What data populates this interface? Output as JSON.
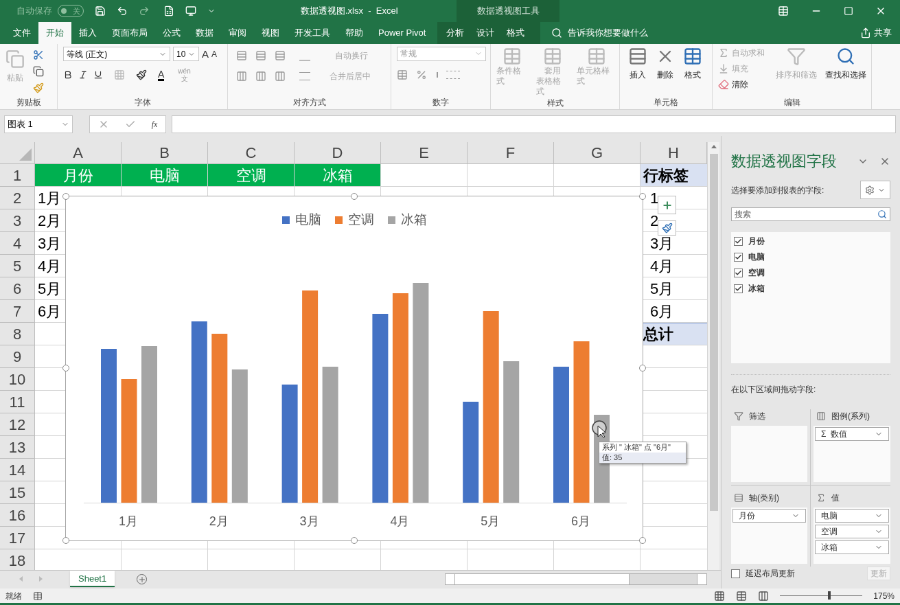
{
  "title_bar": {
    "autosave_label": "自动保存",
    "autosave_toggle": "关",
    "file_title": "数据透视图.xlsx  -  Excel",
    "context_title": "数据透视图工具"
  },
  "tabs": [
    {
      "label": "文件",
      "selected": false
    },
    {
      "label": "开始",
      "selected": true
    },
    {
      "label": "插入",
      "selected": false
    },
    {
      "label": "页面布局",
      "selected": false
    },
    {
      "label": "公式",
      "selected": false
    },
    {
      "label": "数据",
      "selected": false
    },
    {
      "label": "审阅",
      "selected": false
    },
    {
      "label": "视图",
      "selected": false
    },
    {
      "label": "开发工具",
      "selected": false
    },
    {
      "label": "帮助",
      "selected": false
    },
    {
      "label": "Power Pivot",
      "selected": false
    }
  ],
  "context_tabs": [
    {
      "label": "分析",
      "selected": false
    },
    {
      "label": "设计",
      "selected": false
    },
    {
      "label": "格式",
      "selected": false
    }
  ],
  "tell_me": "告诉我你想要做什么",
  "share": "共享",
  "ribbon": {
    "clipboard": {
      "paste": "粘贴",
      "paste_disabled": true,
      "group": "剪贴板"
    },
    "font": {
      "name": "等线 (正文)",
      "size": "10",
      "grow": "A",
      "shrink": "A",
      "color_letter": "A",
      "phonetic_top": "wén",
      "phonetic_bottom": "文",
      "group": "字体"
    },
    "alignment": {
      "wrap": "自动换行",
      "merge": "合并后居中",
      "disabled": true,
      "group": "对齐方式"
    },
    "number": {
      "format": "常规",
      "group": "数字"
    },
    "styles": {
      "items": [
        {
          "lines": [
            "条件格式"
          ],
          "disabled": true
        },
        {
          "lines": [
            "套用",
            "表格格式"
          ],
          "disabled": true
        },
        {
          "lines": [
            "单元格样式"
          ],
          "disabled": true
        }
      ],
      "group": "样式"
    },
    "cells": {
      "items": [
        {
          "label": "插入",
          "kind": "insert"
        },
        {
          "label": "删除",
          "kind": "delete"
        },
        {
          "label": "格式",
          "kind": "format"
        }
      ],
      "group": "单元格"
    },
    "editing": {
      "small": [
        {
          "label": "自动求和",
          "kind": "sum",
          "disabled": true
        },
        {
          "label": "填充",
          "kind": "fill",
          "disabled": true
        },
        {
          "label": "清除",
          "kind": "clear",
          "disabled": false
        }
      ],
      "sort": "排序和筛选",
      "sort_disabled": true,
      "find": "查找和选择",
      "group": "编辑"
    }
  },
  "formula_bar": {
    "name_box": "图表 1",
    "fx": "fx"
  },
  "sheet": {
    "columns": [
      "A",
      "B",
      "C",
      "D",
      "E",
      "F",
      "G",
      "H"
    ],
    "rows": [
      {
        "number": "1",
        "cells": [
          {
            "text": "月份",
            "kind": "field_header"
          },
          {
            "text": "电脑",
            "kind": "field_header"
          },
          {
            "text": "空调",
            "kind": "field_header"
          },
          {
            "text": "冰箱",
            "kind": "field_header"
          },
          null,
          null,
          null,
          {
            "text": "行标签",
            "kind": "pivot_header"
          }
        ]
      },
      {
        "number": "2",
        "cells": [
          {
            "text": "1月",
            "kind": "plain"
          },
          null,
          null,
          null,
          null,
          null,
          null,
          {
            "text": "1",
            "kind": "plain"
          }
        ]
      },
      {
        "number": "3",
        "cells": [
          {
            "text": "2月",
            "kind": "plain"
          },
          null,
          null,
          null,
          null,
          null,
          null,
          {
            "text": "2",
            "kind": "plain"
          }
        ]
      },
      {
        "number": "4",
        "cells": [
          {
            "text": "3月",
            "kind": "plain"
          },
          null,
          null,
          null,
          null,
          null,
          null,
          {
            "text": "3月",
            "kind": "plain"
          }
        ]
      },
      {
        "number": "5",
        "cells": [
          {
            "text": "4月",
            "kind": "plain"
          },
          null,
          null,
          null,
          null,
          null,
          null,
          {
            "text": "4月",
            "kind": "plain"
          }
        ]
      },
      {
        "number": "6",
        "cells": [
          {
            "text": "5月",
            "kind": "plain"
          },
          null,
          null,
          null,
          null,
          null,
          null,
          {
            "text": "5月",
            "kind": "plain"
          }
        ]
      },
      {
        "number": "7",
        "cells": [
          {
            "text": "6月",
            "kind": "plain"
          },
          null,
          null,
          null,
          null,
          null,
          null,
          {
            "text": "6月",
            "kind": "plain"
          }
        ]
      },
      {
        "number": "8",
        "cells": [
          null,
          null,
          null,
          null,
          null,
          null,
          null,
          {
            "text": "总计",
            "kind": "pivot_total"
          }
        ]
      },
      {
        "number": "9"
      },
      {
        "number": "10"
      },
      {
        "number": "11"
      },
      {
        "number": "12"
      },
      {
        "number": "13"
      },
      {
        "number": "14"
      },
      {
        "number": "15"
      },
      {
        "number": "16"
      },
      {
        "number": "17"
      },
      {
        "number": "18"
      }
    ]
  },
  "chart": {
    "legend": [
      {
        "name": "电脑",
        "color": "#4472c4"
      },
      {
        "name": "空调",
        "color": "#ed7d31"
      },
      {
        "name": "冰箱",
        "color": "#a5a5a5"
      }
    ],
    "categories": [
      "1月",
      "2月",
      "3月",
      "4月",
      "5月",
      "6月"
    ],
    "tooltip": {
      "line1": "系列 \" 冰箱\" 点 \"6月\"",
      "line2": "值: 35"
    }
  },
  "sheet_tabs": [
    {
      "label": "Sheet1",
      "selected": true
    }
  ],
  "pane": {
    "title": "数据透视图字段",
    "subtitle": "选择要添加到报表的字段:",
    "search_placeholder": "搜索",
    "fields": [
      {
        "label": "月份",
        "checked": true
      },
      {
        "label": "电脑",
        "checked": true
      },
      {
        "label": "空调",
        "checked": true
      },
      {
        "label": "冰箱",
        "checked": true
      }
    ],
    "drag_label": "在以下区域间拖动字段:",
    "areas": [
      {
        "title": "筛选",
        "kind": "filter"
      },
      {
        "title": "图例(系列)",
        "kind": "legend",
        "items": [
          "Σ  数值"
        ]
      },
      {
        "title": "轴(类别)",
        "kind": "axis",
        "items": [
          "月份"
        ]
      },
      {
        "title": "值",
        "kind": "values",
        "items": [
          "电脑",
          "空调",
          "冰箱"
        ]
      }
    ],
    "defer": {
      "label": "延迟布局更新",
      "checked": false
    },
    "update": "更新"
  },
  "status_bar": {
    "ready": "就绪",
    "level": 0.6,
    "zoom": "175%"
  }
}
